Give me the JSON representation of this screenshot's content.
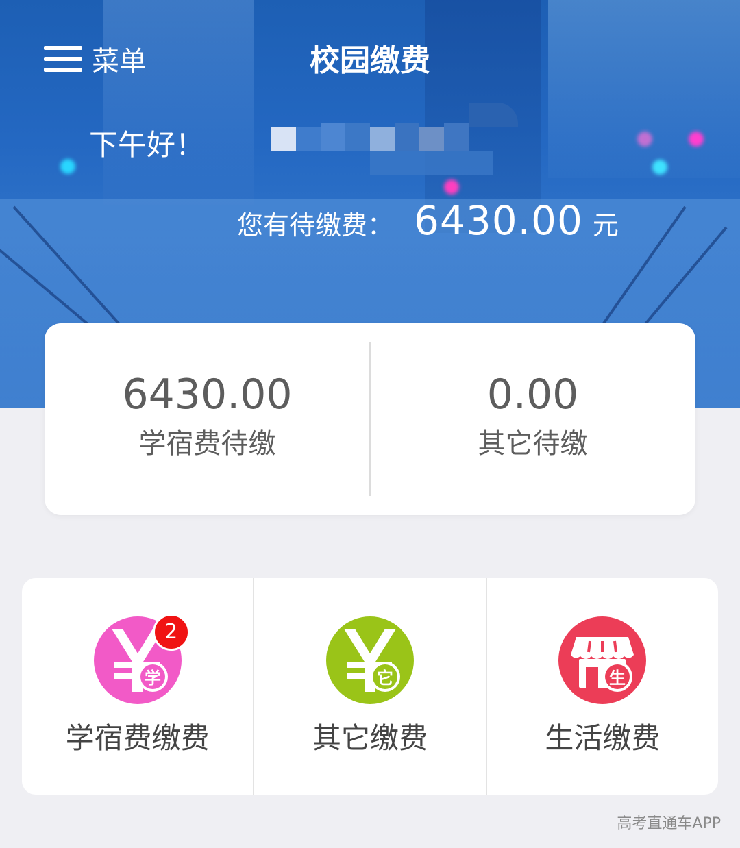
{
  "header": {
    "menu_label": "菜单",
    "title": "校园缴费",
    "greeting": "下午好！",
    "due_label": "您有待缴费：",
    "due_amount": "6430.00",
    "due_unit": "元"
  },
  "summary": [
    {
      "amount": "6430.00",
      "label": "学宿费待缴"
    },
    {
      "amount": "0.00",
      "label": "其它待缴"
    }
  ],
  "services": [
    {
      "label": "学宿费缴费",
      "icon": "yuan-xue-icon",
      "icon_char": "学",
      "color": "#f25ac7",
      "badge": "2"
    },
    {
      "label": "其它缴费",
      "icon": "yuan-ta-icon",
      "icon_char": "它",
      "color": "#9ac418"
    },
    {
      "label": "生活缴费",
      "icon": "store-sheng-icon",
      "icon_char": "生",
      "color": "#ec3d57"
    }
  ],
  "watermark": "高考直通车APP"
}
